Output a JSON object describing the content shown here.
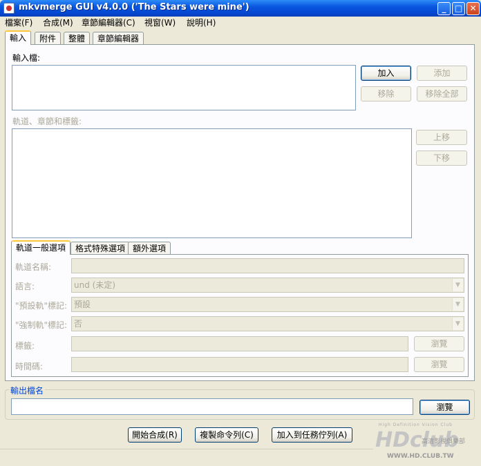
{
  "window": {
    "title": "mkvmerge GUI v4.0.0 ('The Stars were mine')",
    "controls": {
      "minimize": "_",
      "maximize": "□",
      "close": "✕"
    }
  },
  "menu": [
    "檔案(F)",
    "合成(M)",
    "章節編輯器(C)",
    "視窗(W)",
    "說明(H)"
  ],
  "tabs": [
    "輸入",
    "附件",
    "整體",
    "章節編輯器"
  ],
  "input": {
    "files_label": "輸入檔:",
    "add": "加入",
    "append": "添加",
    "remove": "移除",
    "remove_all": "移除全部",
    "tracks_label": "軌道、章節和標籤:",
    "up": "上移",
    "down": "下移"
  },
  "subtabs": [
    "軌道一般選項",
    "格式特殊選項",
    "額外選項"
  ],
  "options": {
    "track_name_label": "軌道名稱:",
    "language_label": "語言:",
    "language_value": "und (未定)",
    "default_flag_label": "\"預設軌\"標記:",
    "default_flag_value": "預設",
    "forced_flag_label": "\"強制軌\"標記:",
    "forced_flag_value": "否",
    "tags_label": "標籤:",
    "timecodes_label": "時間碼:",
    "browse": "瀏覽"
  },
  "output": {
    "group_label": "輸出檔名",
    "browse": "瀏覽",
    "filename": ""
  },
  "actions": {
    "start": "開始合成(R)",
    "copy_cmd": "複製命令列(C)",
    "add_job": "加入到任務佇列(A)"
  },
  "watermark": {
    "tagline": "High Definition Vision Club",
    "logo": "HDclub",
    "cn": "高清影視俱樂部",
    "url": "WWW.HD.CLUB.TW"
  },
  "colors": {
    "titlebar": "#0a57e0",
    "accent_tab": "#ffc83c",
    "group_title": "#0046d5"
  }
}
